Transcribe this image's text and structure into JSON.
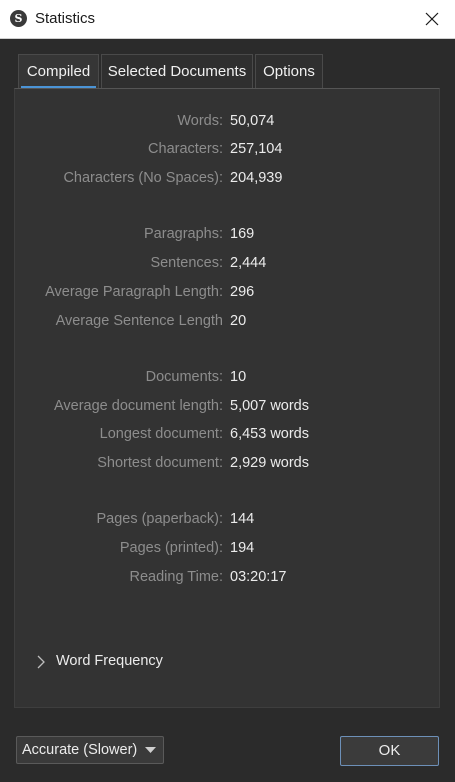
{
  "window": {
    "title": "Statistics",
    "app_icon_glyph": "S",
    "close_icon": "close-icon"
  },
  "tabs": [
    {
      "label": "Compiled",
      "active": true
    },
    {
      "label": "Selected Documents",
      "active": false
    },
    {
      "label": "Options",
      "active": false
    }
  ],
  "stats": [
    {
      "label": "Words:",
      "value": "50,074"
    },
    {
      "label": "Characters:",
      "value": "257,104"
    },
    {
      "label": "Characters (No Spaces):",
      "value": "204,939"
    },
    {
      "label": "Paragraphs:",
      "value": "169"
    },
    {
      "label": "Sentences:",
      "value": "2,444"
    },
    {
      "label": "Average Paragraph Length:",
      "value": "296"
    },
    {
      "label": "Average Sentence Length",
      "value": "20"
    },
    {
      "label": "Documents:",
      "value": "10"
    },
    {
      "label": "Average document length:",
      "value": "5,007 words"
    },
    {
      "label": "Longest document:",
      "value": "6,453 words"
    },
    {
      "label": "Shortest document:",
      "value": "2,929 words"
    },
    {
      "label": "Pages (paperback):",
      "value": "144"
    },
    {
      "label": "Pages (printed):",
      "value": "194"
    },
    {
      "label": "Reading Time:",
      "value": "03:20:17"
    }
  ],
  "word_frequency": {
    "label": "Word Frequency",
    "expanded": false
  },
  "footer": {
    "accuracy_select": "Accurate (Slower)",
    "ok_label": "OK"
  },
  "colors": {
    "accent": "#4b94d6",
    "background": "#2b2b2b",
    "label_text": "#8d8d8d",
    "value_text": "#ececec"
  }
}
